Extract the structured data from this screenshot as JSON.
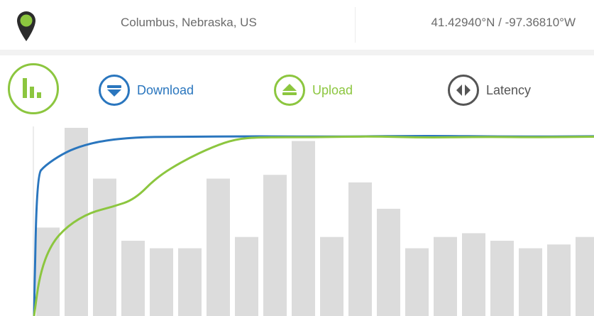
{
  "header": {
    "location": "Columbus, Nebraska, US",
    "coordinates": "41.42940°N / -97.36810°W",
    "pin_icon": "map-pin-icon"
  },
  "legend": {
    "download": {
      "label": "Download",
      "color": "#2a76be",
      "icon": "arrow-down-circle-icon"
    },
    "upload": {
      "label": "Upload",
      "color": "#8cc63f",
      "icon": "arrow-up-circle-icon"
    },
    "latency": {
      "label": "Latency",
      "color": "#555555",
      "icon": "left-right-circle-icon"
    }
  },
  "chart_toggle": {
    "icon": "bar-chart-icon",
    "color": "#8cc63f"
  },
  "chart_data": {
    "type": "bar",
    "bar_color": "#dcdcdc",
    "bars": [
      0.47,
      1.0,
      0.73,
      0.4,
      0.36,
      0.36,
      0.73,
      0.42,
      0.75,
      0.93,
      0.42,
      0.71,
      0.57,
      0.36,
      0.42,
      0.44,
      0.4,
      0.36,
      0.38,
      0.42
    ],
    "series": [
      {
        "name": "Download",
        "color": "#2a76be",
        "points": [
          [
            0,
            0
          ],
          [
            0.005,
            0.75
          ],
          [
            0.02,
            0.8
          ],
          [
            0.05,
            0.86
          ],
          [
            0.08,
            0.9
          ],
          [
            0.12,
            0.93
          ],
          [
            0.18,
            0.95
          ],
          [
            0.25,
            0.953
          ],
          [
            0.4,
            0.955
          ],
          [
            0.55,
            0.953
          ],
          [
            0.7,
            0.958
          ],
          [
            0.85,
            0.953
          ],
          [
            1,
            0.955
          ]
        ]
      },
      {
        "name": "Upload",
        "color": "#8cc63f",
        "points": [
          [
            0,
            0
          ],
          [
            0.01,
            0.22
          ],
          [
            0.03,
            0.38
          ],
          [
            0.06,
            0.48
          ],
          [
            0.1,
            0.55
          ],
          [
            0.14,
            0.58
          ],
          [
            0.18,
            0.62
          ],
          [
            0.22,
            0.74
          ],
          [
            0.27,
            0.83
          ],
          [
            0.32,
            0.9
          ],
          [
            0.36,
            0.94
          ],
          [
            0.4,
            0.95
          ],
          [
            0.5,
            0.95
          ],
          [
            0.6,
            0.955
          ],
          [
            0.7,
            0.948
          ],
          [
            0.8,
            0.952
          ],
          [
            0.9,
            0.95
          ],
          [
            1,
            0.953
          ]
        ]
      }
    ]
  }
}
